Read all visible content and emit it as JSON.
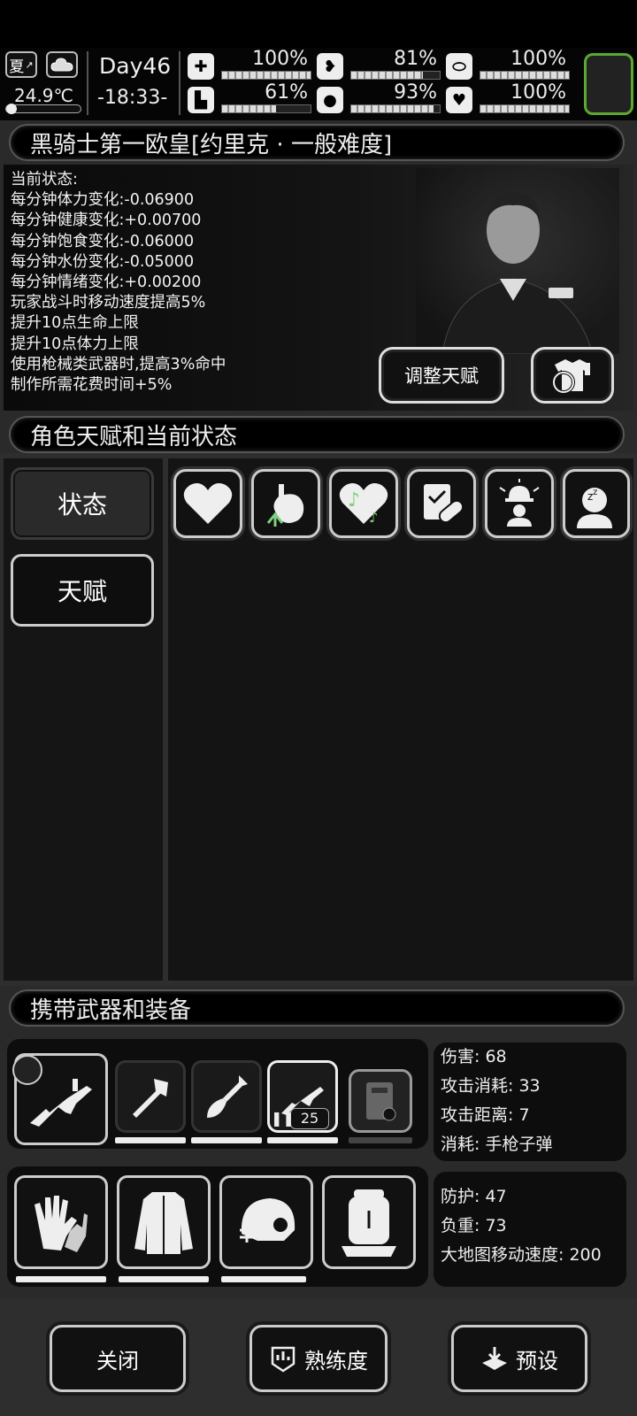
{
  "hud": {
    "season": "夏",
    "weather_icon": "cloud-icon",
    "temperature": "24.9℃",
    "day": "Day46",
    "time": "-18:33-",
    "stats": [
      {
        "name": "health",
        "icon": "medkit-icon",
        "value": "100%",
        "fraction": 1.0
      },
      {
        "name": "hunger",
        "icon": "stomach-icon",
        "value": "81%",
        "fraction": 0.81
      },
      {
        "name": "armor",
        "icon": "capsule-icon",
        "value": "100%",
        "fraction": 1.0
      },
      {
        "name": "stamina",
        "icon": "boot-icon",
        "value": "61%",
        "fraction": 0.61
      },
      {
        "name": "water",
        "icon": "water-drop-icon",
        "value": "93%",
        "fraction": 0.93
      },
      {
        "name": "mood",
        "icon": "heart-icon",
        "value": "100%",
        "fraction": 1.0
      }
    ],
    "minimap_color": "#5ca833"
  },
  "character": {
    "title": "黑骑士第一欧皇[约里克 · 一般难度]",
    "status_header": "当前状态:",
    "status_lines": [
      "每分钟体力变化:-0.06900",
      "每分钟健康变化:+0.00700",
      "每分钟饱食变化:-0.06000",
      "每分钟水份变化:-0.05000",
      "每分钟情绪变化:+0.00200",
      "玩家战斗时移动速度提高5%",
      "提升10点生命上限",
      "提升10点体力上限",
      "使用枪械类武器时,提高3%命中",
      "制作所需花费时间+5%"
    ],
    "adjust_talent_label": "调整天赋",
    "change_outfit_icon": "outfit-swap-icon"
  },
  "talents": {
    "header": "角色天赋和当前状态",
    "tabs": [
      {
        "label": "状态",
        "active": true
      },
      {
        "label": "天赋",
        "active": false
      }
    ],
    "status_icons": [
      "heart-icon",
      "stomach-icon",
      "music-heart-icon",
      "medical-clipboard-icon",
      "alarm-person-icon",
      "sleeping-person-icon"
    ]
  },
  "equipment": {
    "header": "携带武器和装备",
    "weapon_slots": [
      {
        "icon": "smg-icon",
        "selected": true
      },
      {
        "icon": "axe-icon",
        "durability": 0.95
      },
      {
        "icon": "shovel-icon",
        "durability": 0.95
      },
      {
        "icon": "smg-icon",
        "ammo": "25",
        "durability": 0.95
      },
      {
        "icon": "riot-shield-icon",
        "durability": 0.0
      }
    ],
    "weapon_stats": [
      "伤害: 68",
      "攻击消耗: 33",
      "攻击距离: 7",
      "消耗: 手枪子弹"
    ],
    "armor_slots": [
      {
        "icon": "gloves-icon",
        "durability": 1.0
      },
      {
        "icon": "jacket-icon",
        "durability": 1.0
      },
      {
        "icon": "helmet-icon",
        "durability": 0.95
      },
      {
        "icon": "backpack-icon"
      }
    ],
    "armor_stats": [
      "防护: 47",
      "负重: 73",
      "大地图移动速度: 200"
    ]
  },
  "buttons": {
    "close": "关闭",
    "proficiency": "熟练度",
    "preset": "预设"
  }
}
